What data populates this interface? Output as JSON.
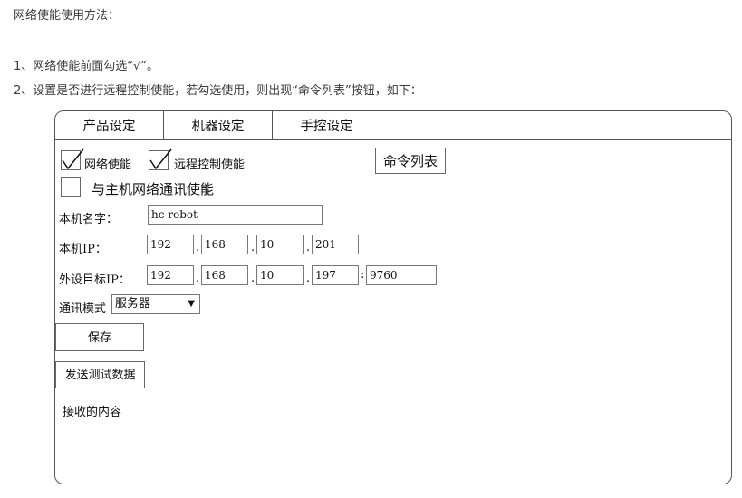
{
  "doc": {
    "line0": "网络使能使用方法：",
    "line1": "1、网络使能前面勾选“√”。",
    "line2": "2、设置是否进行远程控制使能，若勾选使用，则出现“命令列表”按钮，如下："
  },
  "tabs": [
    "产品设定",
    "机器设定",
    "手控设定"
  ],
  "checks": {
    "network_label": "网络使能",
    "remote_label": "远程控制使能",
    "host_label": "与主机网络通讯使能"
  },
  "cmd_list_button": "命令列表",
  "local_name": {
    "label": "本机名字：",
    "value": "hc robot"
  },
  "local_ip": {
    "label": "本机IP：",
    "octets": [
      "192",
      "168",
      "10",
      "201"
    ]
  },
  "ext_ip": {
    "label": "外设目标IP：",
    "octets": [
      "192",
      "168",
      "10",
      "197"
    ],
    "port": "9760"
  },
  "comm_mode": {
    "label": "通讯模式",
    "value": "服务器"
  },
  "save_button": "保存",
  "send_test_button": "发送测试数据",
  "receive_label": "接收的内容"
}
